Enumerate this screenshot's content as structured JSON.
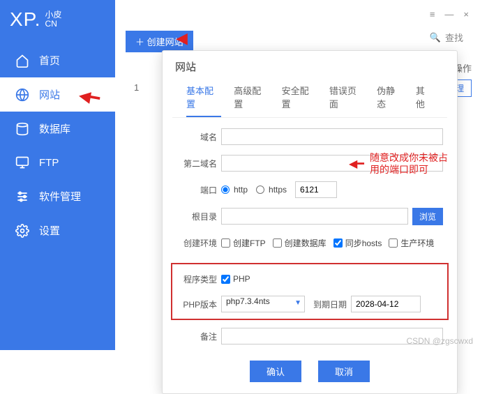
{
  "logo": {
    "xp": "XP.",
    "small1": "小皮",
    "cn": "CN"
  },
  "sidebar": {
    "items": [
      {
        "label": "首页"
      },
      {
        "label": "网站"
      },
      {
        "label": "数据库"
      },
      {
        "label": "FTP"
      },
      {
        "label": "软件管理"
      },
      {
        "label": "设置"
      }
    ]
  },
  "toolbar": {
    "create_label": "创建网站",
    "search_label": "查找"
  },
  "main": {
    "operate_header": "操作",
    "manage_label": "管理",
    "row_num": "1"
  },
  "modal": {
    "title": "网站",
    "tabs": [
      "基本配置",
      "高级配置",
      "安全配置",
      "错误页面",
      "伪静态",
      "其他"
    ],
    "labels": {
      "domain": "域名",
      "second_domain": "第二域名",
      "port": "端口",
      "http": "http",
      "https": "https",
      "port_value": "6121",
      "root": "根目录",
      "browse": "浏览",
      "env": "创建环境",
      "create_ftp": "创建FTP",
      "create_db": "创建数据库",
      "sync_hosts": "同步hosts",
      "prod_env": "生产环境",
      "prog_type": "程序类型",
      "php": "PHP",
      "php_ver": "PHP版本",
      "php_ver_val": "php7.3.4nts",
      "expire": "到期日期",
      "expire_val": "2028-04-12",
      "remark": "备注"
    },
    "buttons": {
      "ok": "确认",
      "cancel": "取消"
    }
  },
  "annotation": {
    "line1": "随意改成你未被占",
    "line2": "用的端口即可"
  },
  "watermark": "CSDN @zgscwxd"
}
